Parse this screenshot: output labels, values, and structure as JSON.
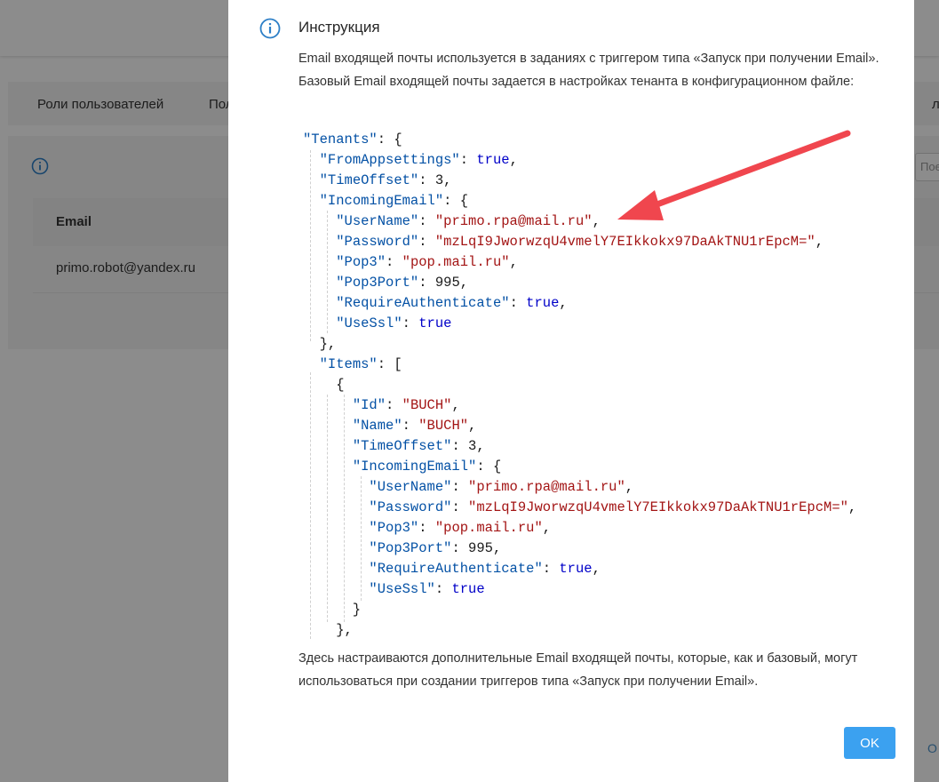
{
  "background": {
    "tabs": [
      "Роли пользователей",
      "Пол",
      "ла"
    ],
    "table_header_email": "Email",
    "table_row_email": "primo.robot@yandex.ru",
    "search_placeholder": "Пое",
    "edge_text": "O"
  },
  "modal": {
    "title": "Инструкция",
    "intro": "Email входящей почты используется в заданиях с триггером типа «Запуск при получении Email». Базовый Email входящей почты задается в настройках тенанта в конфигурационном файле:",
    "outro": "Здесь настраиваются дополнительные Email входящей почты, которые, как и базовый, могут использоваться при создании триггеров типа «Запуск при получении Email».",
    "ok_label": "OK"
  },
  "code": {
    "tenants_key": "\"Tenants\"",
    "from_appsettings_key": "\"FromAppsettings\"",
    "from_appsettings_val": "true",
    "time_offset_key": "\"TimeOffset\"",
    "time_offset_val": "3",
    "incoming_email_key": "\"IncomingEmail\"",
    "username_key": "\"UserName\"",
    "username_val": "\"primo.rpa@mail.ru\"",
    "password_key": "\"Password\"",
    "password_val": "\"mzLqI9JworwzqU4vmelY7EIkkokx97DaAkTNU1rEpcM=\"",
    "pop3_key": "\"Pop3\"",
    "pop3_val": "\"pop.mail.ru\"",
    "pop3port_key": "\"Pop3Port\"",
    "pop3port_val": "995",
    "require_auth_key": "\"RequireAuthenticate\"",
    "require_auth_val": "true",
    "usessl_key": "\"UseSsl\"",
    "usessl_val": "true",
    "items_key": "\"Items\"",
    "id_key": "\"Id\"",
    "id_val": "\"BUCH\"",
    "name_key": "\"Name\"",
    "name_val": "\"BUCH\""
  },
  "colors": {
    "accent": "#3ba1f0",
    "arrow": "#f0464e",
    "json_key": "#0451a5",
    "json_string": "#a31515",
    "json_literal": "#0000c8"
  },
  "icons": {
    "modal_icon": "info-circle-icon",
    "background_icon": "info-circle-icon",
    "annotation": "red-arrow-icon"
  }
}
